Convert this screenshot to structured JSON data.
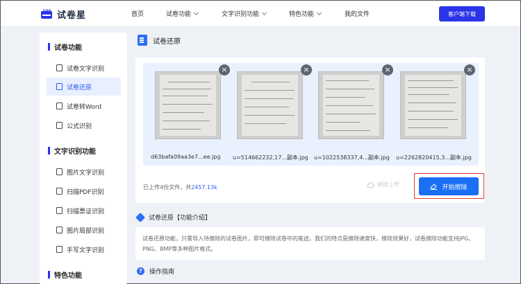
{
  "header": {
    "logo_text": "试卷星",
    "nav": [
      {
        "label": "首页",
        "has_dropdown": false
      },
      {
        "label": "试卷功能",
        "has_dropdown": true
      },
      {
        "label": "文字识别功能",
        "has_dropdown": true
      },
      {
        "label": "特色功能",
        "has_dropdown": true
      },
      {
        "label": "我的文件",
        "has_dropdown": false
      }
    ],
    "download_label": "客户端下载"
  },
  "sidebar": {
    "sections": [
      {
        "title": "试卷功能",
        "items": [
          "试卷文字识别",
          "试卷还原",
          "试卷转Word",
          "公式识别"
        ]
      },
      {
        "title": "文字识别功能",
        "items": [
          "图片文字识别",
          "扫描PDF识别",
          "扫描票证识别",
          "图片局部识别",
          "手写文字识别"
        ]
      },
      {
        "title": "特色功能",
        "items": []
      }
    ],
    "active_item": "试卷还原"
  },
  "main": {
    "title": "试卷还原",
    "files": [
      {
        "name": "d63bafa09aa3e7...ee.jpg"
      },
      {
        "name": "u=514662232,17...副本.jpg"
      },
      {
        "name": "u=1022538337,4...副本.jpg"
      },
      {
        "name": "u=2262820415,3...副本.jpg"
      }
    ],
    "upload_summary_prefix": "已上传4份文件，共",
    "upload_summary_size": "2457.13k",
    "continue_upload_label": "继续上传",
    "start_label": "开始擦除",
    "intro_heading": "试卷还原【功能介绍】",
    "intro_text": "试卷还原功能，只需导入待擦除的试卷图片，即可擦除试卷中的笔迹。我们的特点是擦除速度快，擦除效果好，试卷擦除功能支持JPG、PNG、BMP等多种图片格式。",
    "guide_heading": "操作指南"
  },
  "colors": {
    "brand": "#2a34e8",
    "accent": "#1a6ff5",
    "highlight_border": "#e53935"
  }
}
